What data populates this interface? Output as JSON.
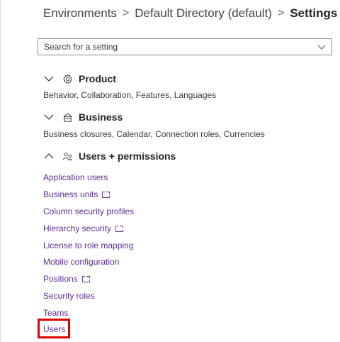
{
  "breadcrumb": {
    "items": [
      "Environments",
      "Default Directory (default)"
    ],
    "current": "Settings",
    "separator": ">"
  },
  "search": {
    "placeholder": "Search for a setting",
    "value": ""
  },
  "sections": {
    "product": {
      "title": "Product",
      "description": "Behavior, Collaboration, Features, Languages",
      "expanded": false,
      "icon": "gear-icon"
    },
    "business": {
      "title": "Business",
      "description": "Business closures, Calendar, Connection roles, Currencies",
      "expanded": false,
      "icon": "building-icon"
    },
    "users_permissions": {
      "title": "Users + permissions",
      "expanded": true,
      "icon": "people-icon",
      "items": [
        {
          "label": "Application users",
          "external": false
        },
        {
          "label": "Business units",
          "external": true
        },
        {
          "label": "Column security profiles",
          "external": false
        },
        {
          "label": "Hierarchy security",
          "external": true
        },
        {
          "label": "License to role mapping",
          "external": false
        },
        {
          "label": "Mobile configuration",
          "external": false
        },
        {
          "label": "Positions",
          "external": true
        },
        {
          "label": "Security roles",
          "external": false
        },
        {
          "label": "Teams",
          "external": false
        },
        {
          "label": "Users",
          "external": false
        }
      ]
    }
  },
  "colors": {
    "link": "#5c2e91",
    "highlight": "#e00000",
    "text": "#242424"
  }
}
